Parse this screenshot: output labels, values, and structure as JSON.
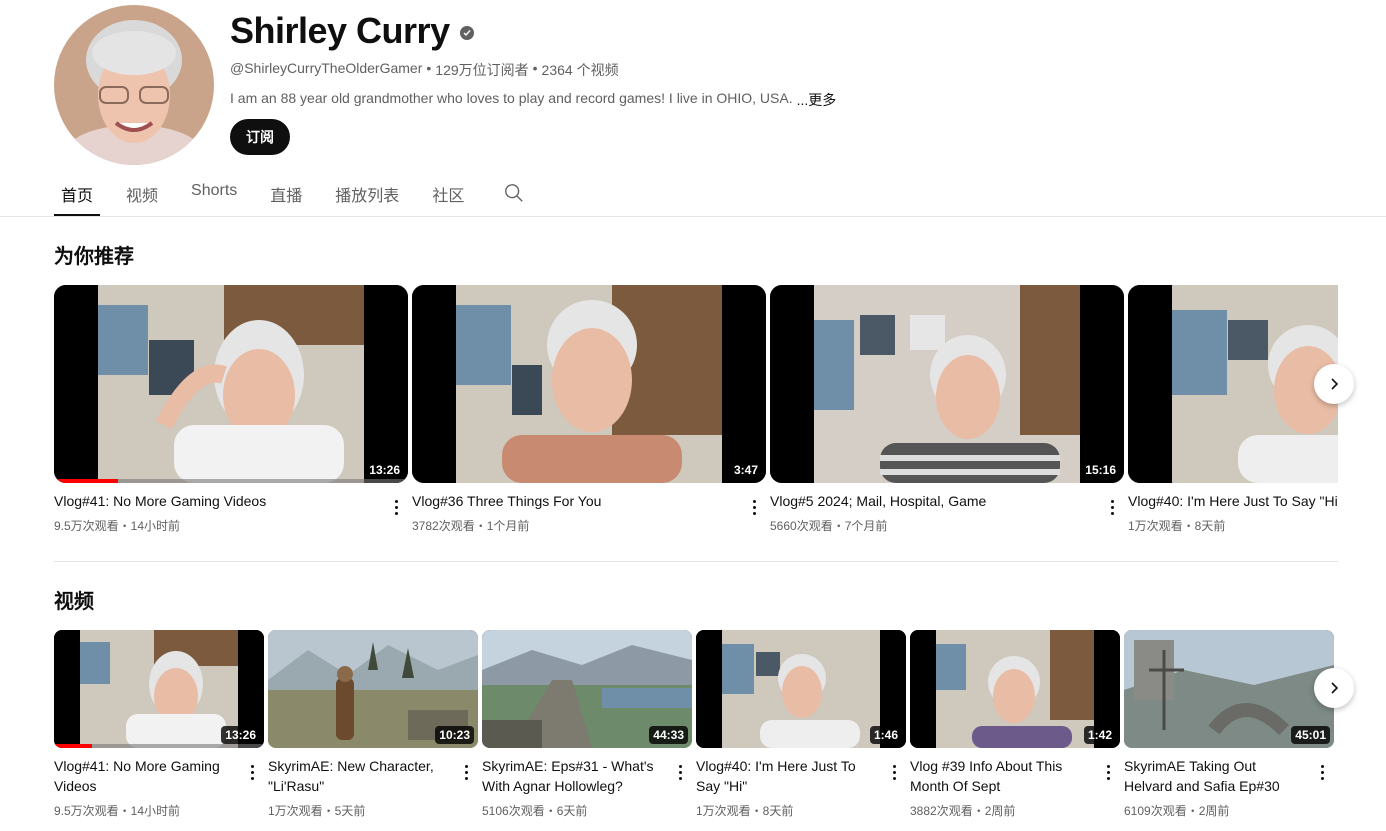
{
  "channel": {
    "name": "Shirley Curry",
    "handle": "@ShirleyCurryTheOlderGamer",
    "subscribers": "129万位订阅者",
    "videos_count": "2364 个视频",
    "separator": "•",
    "description": "I am an 88 year old grandmother who loves to play and record games! I live in OHIO, USA.",
    "more_label": "...更多",
    "subscribe_label": "订阅"
  },
  "tabs": [
    {
      "label": "首页",
      "active": true
    },
    {
      "label": "视频",
      "active": false
    },
    {
      "label": "Shorts",
      "active": false
    },
    {
      "label": "直播",
      "active": false
    },
    {
      "label": "播放列表",
      "active": false
    },
    {
      "label": "社区",
      "active": false
    }
  ],
  "recommended": {
    "title": "为你推荐",
    "items": [
      {
        "title": "Vlog#41: No More Gaming Videos",
        "meta": "9.5万次观看・14小时前",
        "duration": "13:26",
        "progress": 0.18
      },
      {
        "title": "Vlog#36 Three Things For You",
        "meta": "3782次观看・1个月前",
        "duration": "3:47"
      },
      {
        "title": "Vlog#5 2024; Mail, Hospital, Game",
        "meta": "5660次观看・7个月前",
        "duration": "15:16"
      },
      {
        "title": "Vlog#40: I'm Here Just To Say \"Hi\"",
        "meta": "1万次观看・8天前",
        "duration": ""
      }
    ]
  },
  "videos": {
    "title": "视频",
    "items": [
      {
        "title": "Vlog#41: No More Gaming Videos",
        "meta": "9.5万次观看・14小时前",
        "duration": "13:26",
        "progress": 0.18
      },
      {
        "title": "SkyrimAE: New Character, \"Li'Rasu\"",
        "meta": "1万次观看・5天前",
        "duration": "10:23"
      },
      {
        "title": "SkyrimAE: Eps#31 - What's With Agnar Hollowleg?",
        "meta": "5106次观看・6天前",
        "duration": "44:33"
      },
      {
        "title": "Vlog#40: I'm Here Just To Say \"Hi\"",
        "meta": "1万次观看・8天前",
        "duration": "1:46"
      },
      {
        "title": "Vlog #39 Info About This Month Of Sept",
        "meta": "3882次观看・2周前",
        "duration": "1:42"
      },
      {
        "title": "SkyrimAE Taking Out Helvard and Safia Ep#30",
        "meta": "6109次观看・2周前",
        "duration": "45:01"
      }
    ]
  }
}
